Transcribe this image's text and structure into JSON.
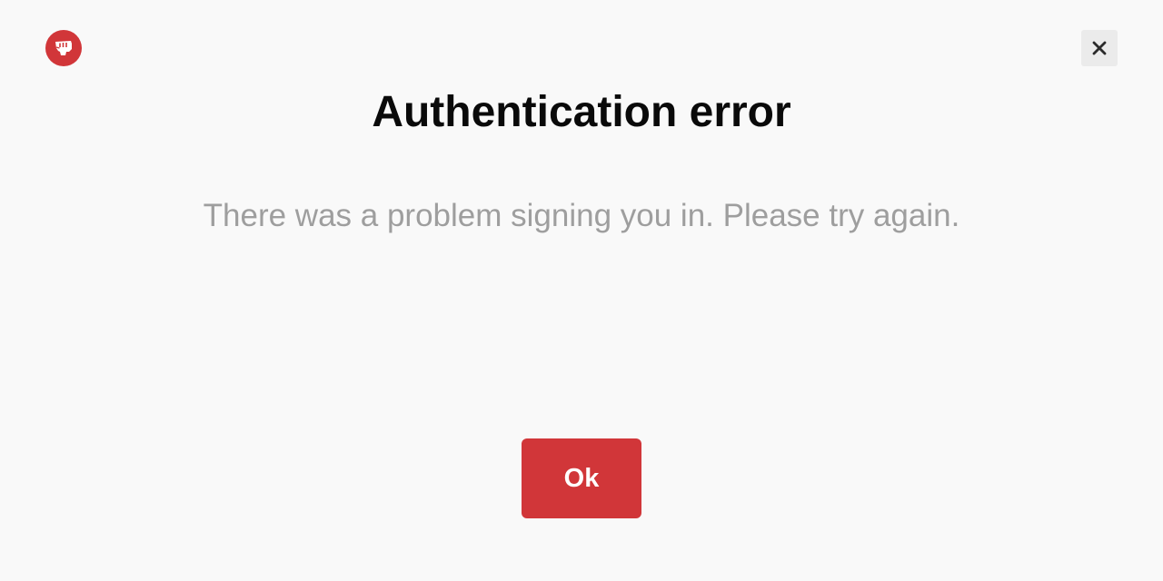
{
  "app": {
    "logo_icon": "riot-fist-logo-icon",
    "brand_color": "#d13639"
  },
  "header": {
    "close_icon": "close-icon"
  },
  "dialog": {
    "title": "Authentication error",
    "message": "There was a problem signing you in. Please try again.",
    "ok_label": "Ok",
    "button_color": "#d13639"
  }
}
